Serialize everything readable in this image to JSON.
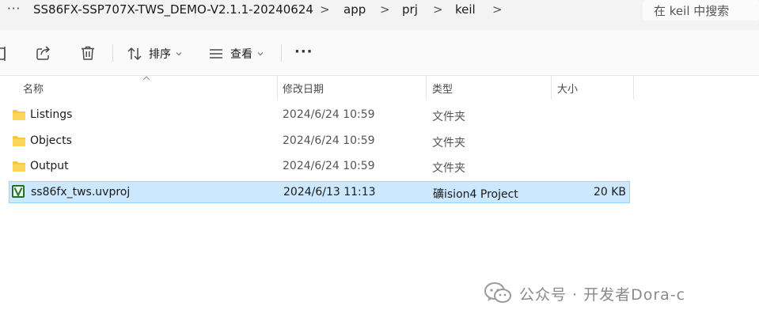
{
  "address": {
    "more_label": "···",
    "crumbs": [
      "SS86FX-SSP707X-TWS_DEMO-V2.1.1-20240624",
      "app",
      "prj",
      "keil"
    ],
    "separator": ">"
  },
  "search": {
    "placeholder": "在 keil 中搜索"
  },
  "toolbar": {
    "sort_label": "排序",
    "view_label": "查看",
    "more_label": "···"
  },
  "columns": {
    "name": "名称",
    "date": "修改日期",
    "type": "类型",
    "size": "大小"
  },
  "rows": [
    {
      "name": "Listings",
      "date": "2024/6/24 10:59",
      "type": "文件夹",
      "size": "",
      "icon": "folder-icon"
    },
    {
      "name": "Objects",
      "date": "2024/6/24 10:59",
      "type": "文件夹",
      "size": "",
      "icon": "folder-icon"
    },
    {
      "name": "Output",
      "date": "2024/6/24 10:59",
      "type": "文件夹",
      "size": "",
      "icon": "folder-icon"
    },
    {
      "name": "ss86fx_tws.uvproj",
      "date": "2024/6/13 11:13",
      "type": "礦ision4 Project",
      "size": "20 KB",
      "icon": "uvision-project-icon",
      "selected": true
    }
  ],
  "watermark": {
    "text": "公众号 · 开发者Dora-c"
  },
  "colors": {
    "selection": "#cce8ff",
    "selection_border": "#99d1ff",
    "folder": "#f8c843",
    "uvision": "#2e7d32"
  }
}
